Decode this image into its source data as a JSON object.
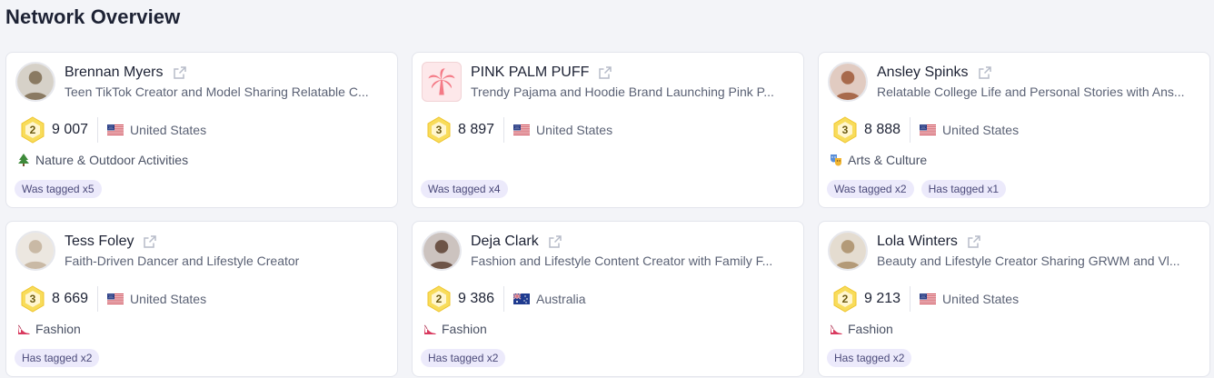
{
  "page": {
    "title": "Network Overview"
  },
  "cards": [
    {
      "name": "Brennan Myers",
      "bio": "Teen TikTok Creator and Model Sharing Relatable C...",
      "badge": "2",
      "score": "9 007",
      "country": "United States",
      "flag": "us-flag",
      "category": "Nature & Outdoor Activities",
      "category_icon": "tree-icon",
      "tags": [
        "Was tagged x5"
      ],
      "avatar": "photo",
      "avatar_color": "#8a7a62"
    },
    {
      "name": "PINK PALM PUFF",
      "bio": "Trendy Pajama and Hoodie Brand Launching Pink P...",
      "badge": "3",
      "score": "8 897",
      "country": "United States",
      "flag": "us-flag",
      "category": "",
      "category_icon": "",
      "tags": [
        "Was tagged x4"
      ],
      "avatar": "palm-logo",
      "avatar_color": "#f47a86"
    },
    {
      "name": "Ansley Spinks",
      "bio": "Relatable College Life and Personal Stories with Ans...",
      "badge": "3",
      "score": "8 888",
      "country": "United States",
      "flag": "us-flag",
      "category": "Arts & Culture",
      "category_icon": "theater-masks-icon",
      "tags": [
        "Was tagged x2",
        "Has tagged x1"
      ],
      "avatar": "photo",
      "avatar_color": "#a86a4c"
    },
    {
      "name": "Tess Foley",
      "bio": "Faith-Driven Dancer and Lifestyle Creator",
      "badge": "3",
      "score": "8 669",
      "country": "United States",
      "flag": "us-flag",
      "category": "Fashion",
      "category_icon": "high-heel-icon",
      "tags": [
        "Has tagged x2"
      ],
      "avatar": "photo",
      "avatar_color": "#c9b9a5"
    },
    {
      "name": "Deja Clark",
      "bio": "Fashion and Lifestyle Content Creator with Family F...",
      "badge": "2",
      "score": "9 386",
      "country": "Australia",
      "flag": "au-flag",
      "category": "Fashion",
      "category_icon": "high-heel-icon",
      "tags": [
        "Has tagged x2"
      ],
      "avatar": "photo",
      "avatar_color": "#6d5447"
    },
    {
      "name": "Lola Winters",
      "bio": "Beauty and Lifestyle Creator Sharing GRWM and Vl...",
      "badge": "2",
      "score": "9 213",
      "country": "United States",
      "flag": "us-flag",
      "category": "Fashion",
      "category_icon": "high-heel-icon",
      "tags": [
        "Has tagged x2"
      ],
      "avatar": "photo",
      "avatar_color": "#b39a78"
    }
  ],
  "colors": {
    "accent_tag_bg": "#eceafb",
    "badge_gold": "#f6d54a"
  }
}
